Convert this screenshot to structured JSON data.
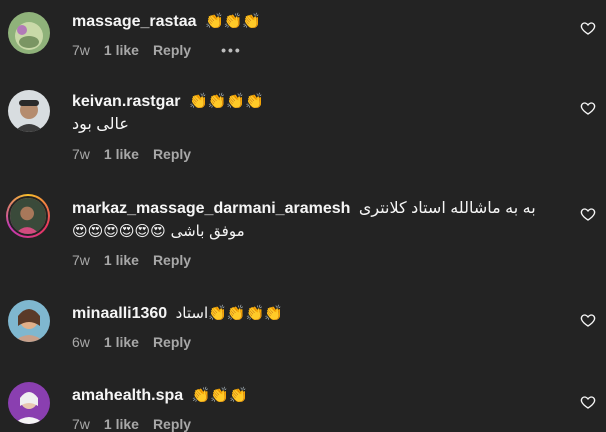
{
  "comments": [
    {
      "username": "massage_rastaa",
      "emojis": "👏👏👏",
      "text": "",
      "time": "7w",
      "likes": "1 like",
      "reply": "Reply",
      "more": "•••"
    },
    {
      "username": "keivan.rastgar",
      "emojis": "👏👏👏👏",
      "text": "عالی بود",
      "time": "7w",
      "likes": "1 like",
      "reply": "Reply"
    },
    {
      "username": "markaz_massage_darmani_aramesh",
      "text": "به به ماشالله استاد کلانتری",
      "text2": "موفق باشی 😍😍😍😍😍😍",
      "time": "7w",
      "likes": "1 like",
      "reply": "Reply"
    },
    {
      "username": "minaalli1360",
      "text": "👏👏👏👏استاد",
      "time": "6w",
      "likes": "1 like",
      "reply": "Reply"
    },
    {
      "username": "amahealth.spa",
      "emojis": "👏👏👏",
      "text": "",
      "time": "7w",
      "likes": "1 like",
      "reply": "Reply"
    }
  ],
  "colors": {
    "background": "#232323",
    "username": "#f5f5f5",
    "meta": "#a8a8a8"
  }
}
